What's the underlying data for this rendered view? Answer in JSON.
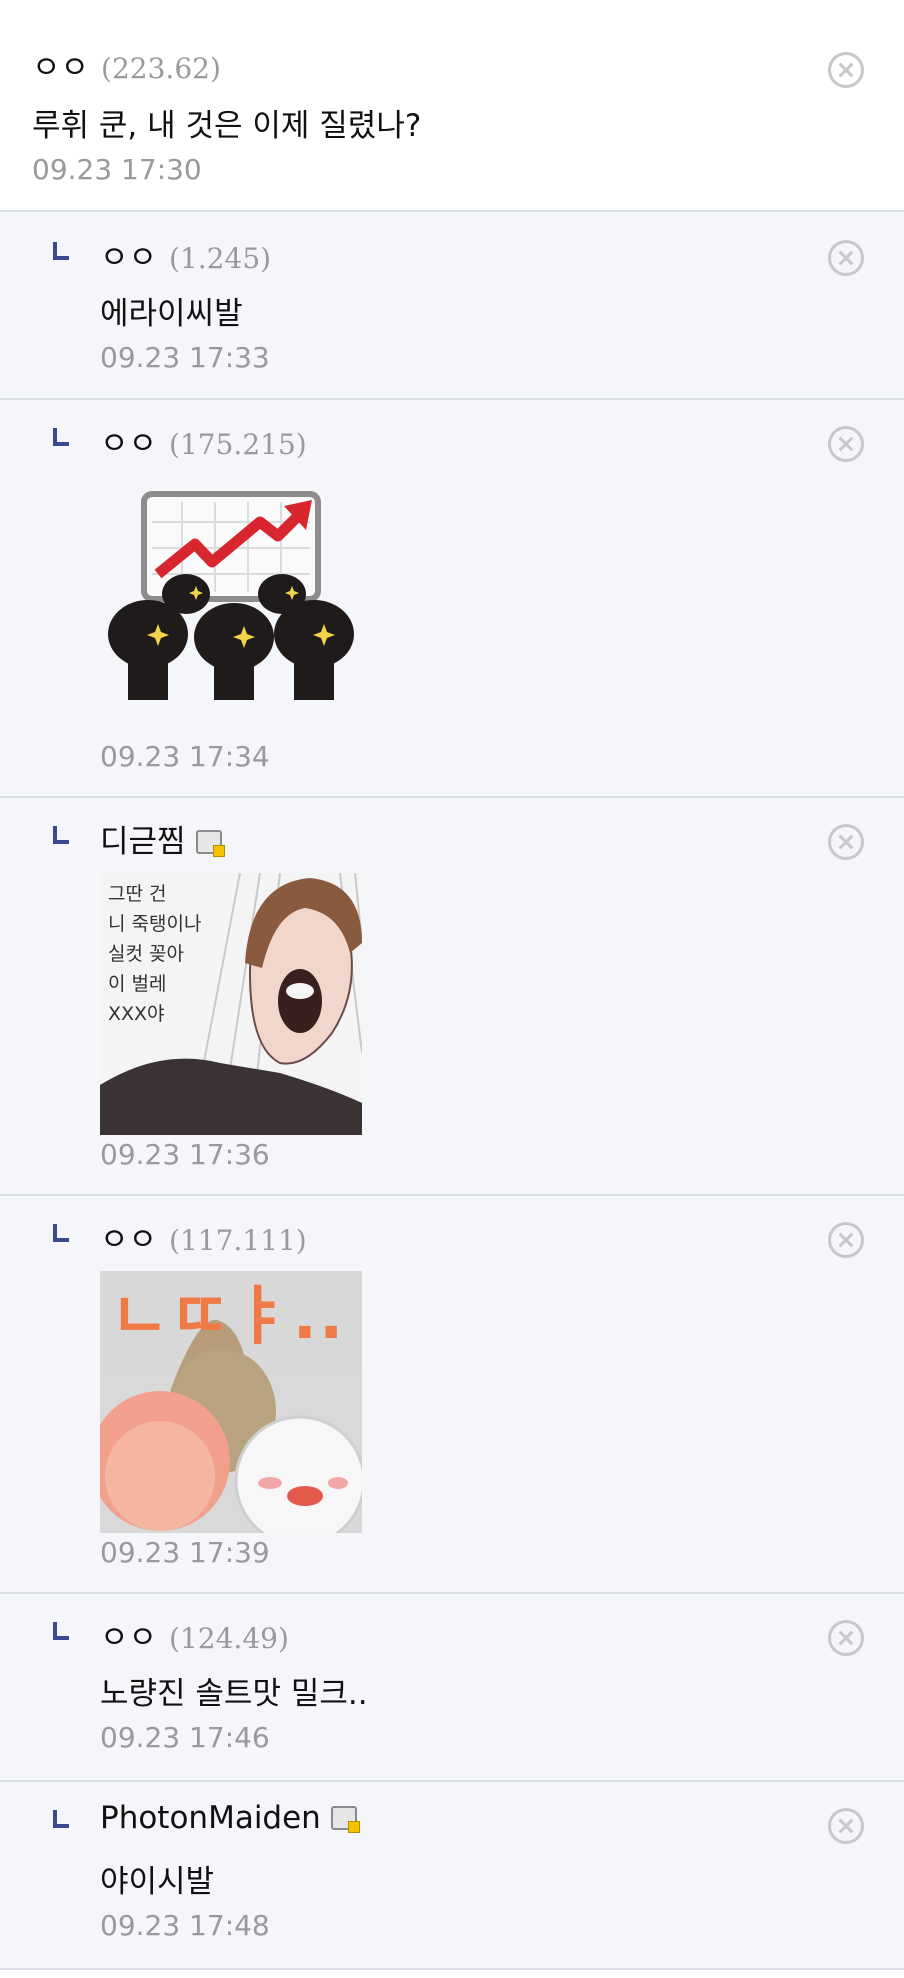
{
  "comments": [
    {
      "nick": "ㅇㅇ",
      "ip": "(223.62)",
      "text": "루휘 쿤, 내 것은 이제 질렸나?",
      "date": "09.23 17:30"
    },
    {
      "nick": "ㅇㅇ",
      "ip": "(1.245)",
      "text": "에라이씨발",
      "date": "09.23 17:33"
    },
    {
      "nick": "ㅇㅇ",
      "ip": "(175.215)",
      "sticker": "stock-chart-dumplings-sticker",
      "date": "09.23 17:34"
    },
    {
      "nick": "디귿찜",
      "gallog_icon": "gallog-icon",
      "comic_caption": "그딴 건\n니 죽탱이나\n실컷 꽂아\n이 벌레\nXXX야",
      "date": "09.23 17:36"
    },
    {
      "nick": "ㅇㅇ",
      "ip": "(117.111)",
      "sticker_text": "ㄴㄸㅑ..",
      "date": "09.23 17:39"
    },
    {
      "nick": "ㅇㅇ",
      "ip": "(124.49)",
      "text": "노량진 솔트맛 밀크..",
      "date": "09.23 17:46"
    },
    {
      "nick": "PhotonMaiden",
      "gallog_icon": "gallog-icon",
      "text": "야이시발",
      "date": "09.23 17:48"
    }
  ],
  "icons": {
    "delete": "close-icon",
    "reply": "reply-arrow-icon"
  },
  "colors": {
    "reply_background": "#f5f6fa",
    "reply_marker": "#3b4a8f",
    "meta_gray": "#9a9a9a",
    "chart_arrow": "#d7262e"
  }
}
